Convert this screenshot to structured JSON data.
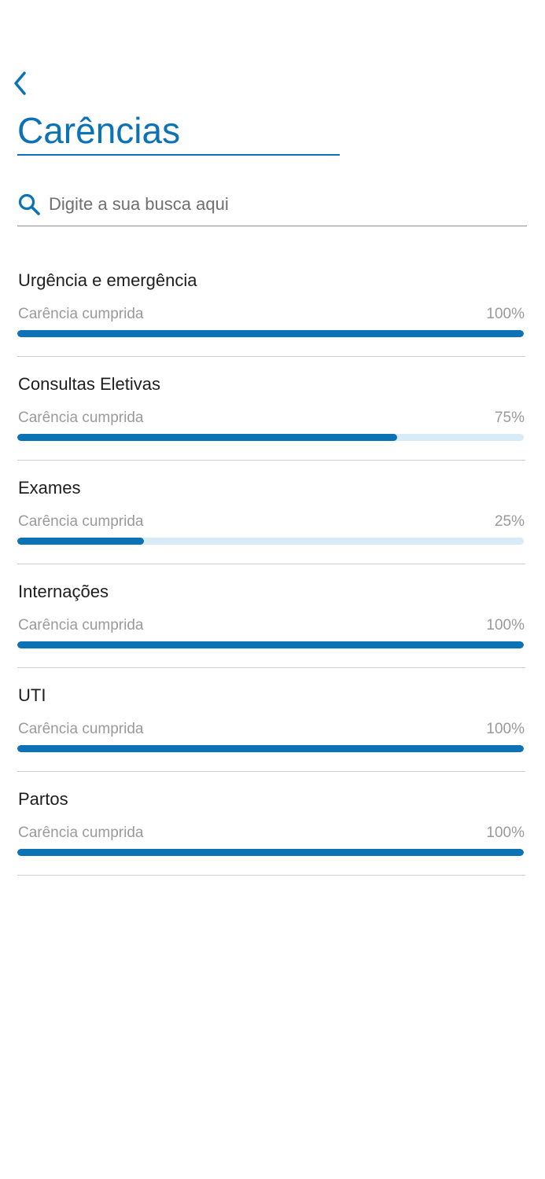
{
  "header": {
    "title": "Carências"
  },
  "search": {
    "placeholder": "Digite a sua busca aqui"
  },
  "icons": {
    "back": "chevron-left-icon",
    "search": "search-icon"
  },
  "colors": {
    "accent": "#0a72b5",
    "track": "#d8ebf6"
  },
  "items": [
    {
      "title": "Urgência e emergência",
      "label": "Carência cumprida",
      "percent_text": "100%",
      "progress": 100
    },
    {
      "title": "Consultas Eletivas",
      "label": "Carência cumprida",
      "percent_text": "75%",
      "progress": 75
    },
    {
      "title": "Exames",
      "label": "Carência cumprida",
      "percent_text": "25%",
      "progress": 25
    },
    {
      "title": "Internações",
      "label": "Carência cumprida",
      "percent_text": "100%",
      "progress": 100
    },
    {
      "title": "UTI",
      "label": "Carência cumprida",
      "percent_text": "100%",
      "progress": 100
    },
    {
      "title": "Partos",
      "label": "Carência cumprida",
      "percent_text": "100%",
      "progress": 100
    }
  ]
}
